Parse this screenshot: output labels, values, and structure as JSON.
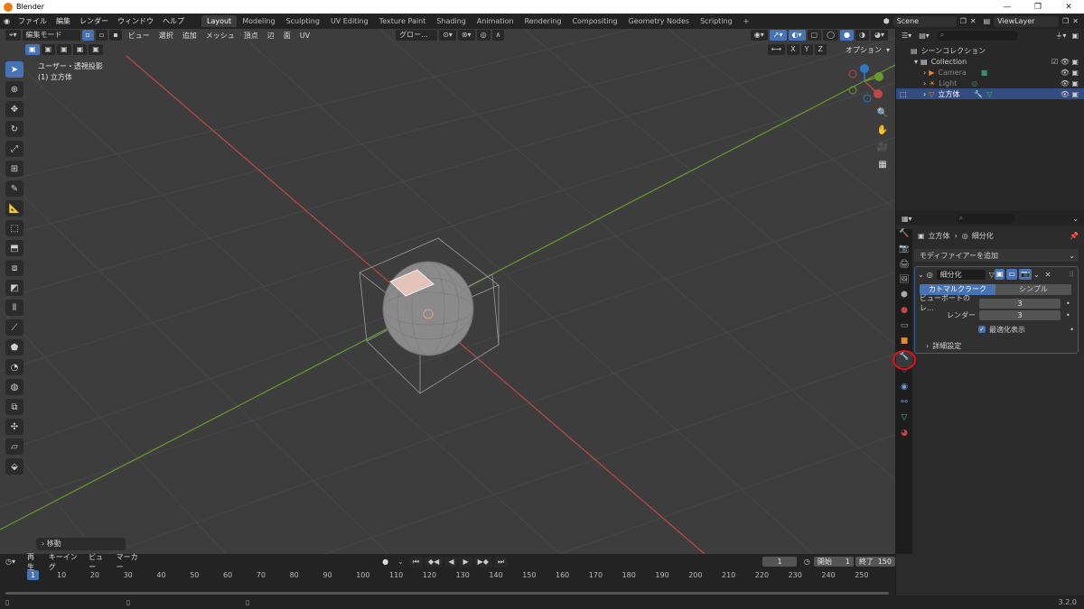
{
  "window": {
    "title": "Blender"
  },
  "menu": {
    "items": [
      "ファイル",
      "編集",
      "レンダー",
      "ウィンドウ",
      "ヘルプ"
    ]
  },
  "workspaces": [
    "Layout",
    "Modeling",
    "Sculpting",
    "UV Editing",
    "Texture Paint",
    "Shading",
    "Animation",
    "Rendering",
    "Compositing",
    "Geometry Nodes",
    "Scripting"
  ],
  "active_workspace": "Layout",
  "scene": {
    "label": "Scene",
    "view_layer": "ViewLayer"
  },
  "viewport": {
    "mode": "編集モード",
    "menus": [
      "ビュー",
      "選択",
      "追加",
      "メッシュ",
      "頂点",
      "辺",
      "面",
      "UV"
    ],
    "orientation": "グロー...",
    "options_label": "オプション",
    "axes": [
      "X",
      "Y",
      "Z"
    ],
    "info_line1": "ユーザー・透視投影",
    "info_line2": "(1) 立方体",
    "last_operator": "移動"
  },
  "outliner": {
    "root": "シーンコレクション",
    "items": [
      {
        "label": "Collection",
        "depth": 1
      },
      {
        "label": "Camera",
        "depth": 2
      },
      {
        "label": "Light",
        "depth": 2
      },
      {
        "label": "立方体",
        "depth": 2,
        "selected": true
      }
    ]
  },
  "properties": {
    "breadcrumb_object": "立方体",
    "breadcrumb_modifier": "細分化",
    "add_modifier_label": "モディファイアーを追加",
    "modifier_name": "細分化",
    "catmull_clark": "カトマルクラーク",
    "simple": "シンプル",
    "viewport_label": "ビューポートのレ...",
    "viewport_value": "3",
    "render_label": "レンダー",
    "render_value": "3",
    "optimal_display": "最適化表示",
    "advanced": "詳細設定"
  },
  "timeline": {
    "menus": [
      "再生",
      "キーイング",
      "ビュー",
      "マーカー"
    ],
    "current_frame": "1",
    "start_label": "開始",
    "start": "1",
    "end_label": "終了",
    "end": "150",
    "ruler": [
      "10",
      "20",
      "30",
      "40",
      "50",
      "60",
      "70",
      "80",
      "90",
      "100",
      "110",
      "120",
      "130",
      "140",
      "150",
      "160",
      "170",
      "180",
      "190",
      "200",
      "210",
      "220",
      "230",
      "240",
      "250"
    ],
    "playhead": "1"
  },
  "status": {
    "version": "3.2.0"
  },
  "colors": {
    "accent": "#4772b3",
    "x_axis": "#c04848",
    "y_axis": "#6a9a2e",
    "highlight_circle": "#e0101a"
  }
}
